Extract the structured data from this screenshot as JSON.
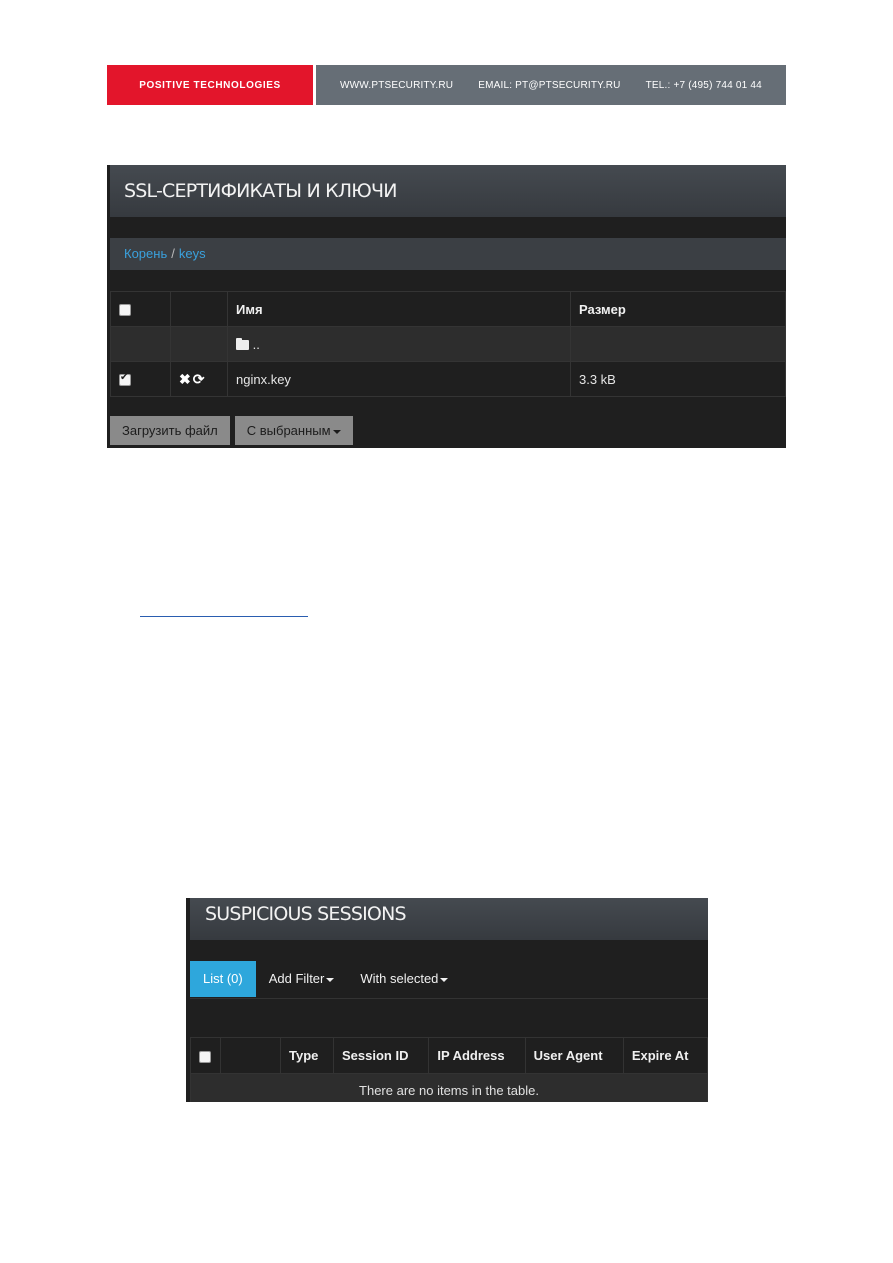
{
  "banner": {
    "brand": "POSITIVE TECHNOLOGIES",
    "website": "WWW.PTSECURITY.RU",
    "email": "EMAIL: PT@PTSECURITY.RU",
    "tel": "TEL.: +7 (495) 744 01 44"
  },
  "ssl_panel": {
    "title": "SSL-СЕРТИФИКАТЫ И КЛЮЧИ",
    "breadcrumb": {
      "root": "Корень",
      "separator": "/",
      "current": "keys"
    },
    "columns": {
      "name": "Имя",
      "size": "Размер"
    },
    "parent_row": {
      "icon": "folder-icon",
      "label": ".."
    },
    "file_row": {
      "checked": true,
      "name": "nginx.key",
      "size": "3.3 kB",
      "delete_icon": "✖",
      "rename_icon": "⟳"
    },
    "buttons": {
      "upload": "Загрузить файл",
      "with_selected": "С выбранным"
    }
  },
  "sessions_panel": {
    "title": "SUSPICIOUS SESSIONS",
    "tabs": {
      "list": "List (0)",
      "add_filter": "Add Filter",
      "with_selected": "With selected"
    },
    "columns": [
      "Type",
      "Session ID",
      "IP Address",
      "User Agent",
      "Expire At"
    ],
    "empty_message": "There are no items in the table."
  },
  "colors": {
    "brand_red": "#e3152b",
    "banner_gray": "#666e76",
    "accent_blue": "#2ea7dc",
    "link_blue": "#3aa1dd"
  }
}
